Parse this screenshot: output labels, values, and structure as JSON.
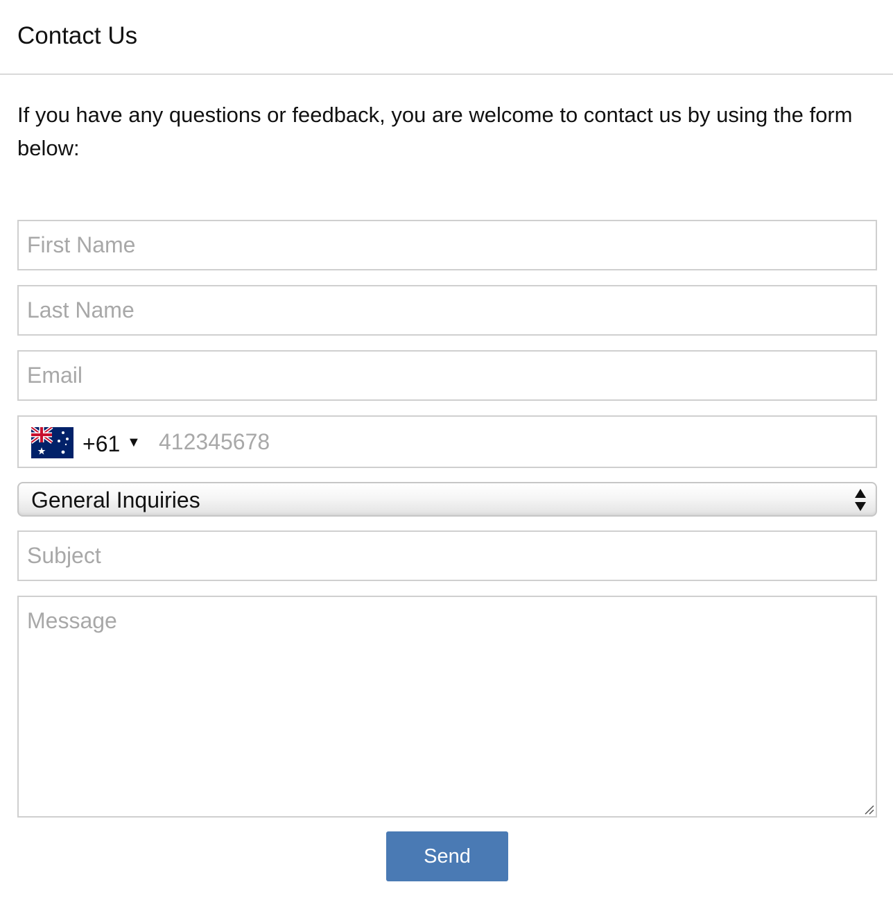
{
  "page": {
    "title": "Contact Us",
    "intro": "If you have any questions or feedback, you are welcome to contact us by using the form below:"
  },
  "form": {
    "first_name": {
      "placeholder": "First Name",
      "value": ""
    },
    "last_name": {
      "placeholder": "Last Name",
      "value": ""
    },
    "email": {
      "placeholder": "Email",
      "value": ""
    },
    "phone": {
      "country_flag_icon": "australia-flag-icon",
      "dial_code": "+61",
      "caret": "▼",
      "placeholder": "412345678",
      "value": ""
    },
    "inquiry_type": {
      "selected": "General Inquiries"
    },
    "subject": {
      "placeholder": "Subject",
      "value": ""
    },
    "message": {
      "placeholder": "Message",
      "value": ""
    },
    "send_label": "Send"
  },
  "colors": {
    "button_bg": "#4a7ab4",
    "border": "#cfcfcf",
    "placeholder": "#a8a8a8"
  }
}
